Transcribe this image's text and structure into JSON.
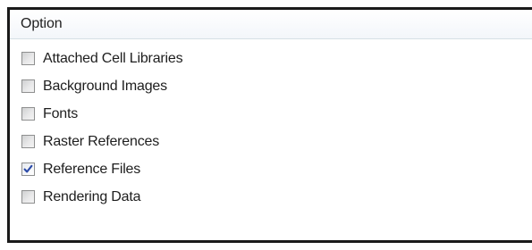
{
  "header": {
    "column_label": "Option"
  },
  "options": [
    {
      "label": "Attached Cell Libraries",
      "checked": false
    },
    {
      "label": "Background Images",
      "checked": false
    },
    {
      "label": "Fonts",
      "checked": false
    },
    {
      "label": "Raster References",
      "checked": false
    },
    {
      "label": "Reference Files",
      "checked": true
    },
    {
      "label": "Rendering Data",
      "checked": false
    }
  ],
  "colors": {
    "check_mark": "#2b4aa8",
    "panel_border": "#1a1a1a",
    "header_divider": "#d5dfe5"
  }
}
